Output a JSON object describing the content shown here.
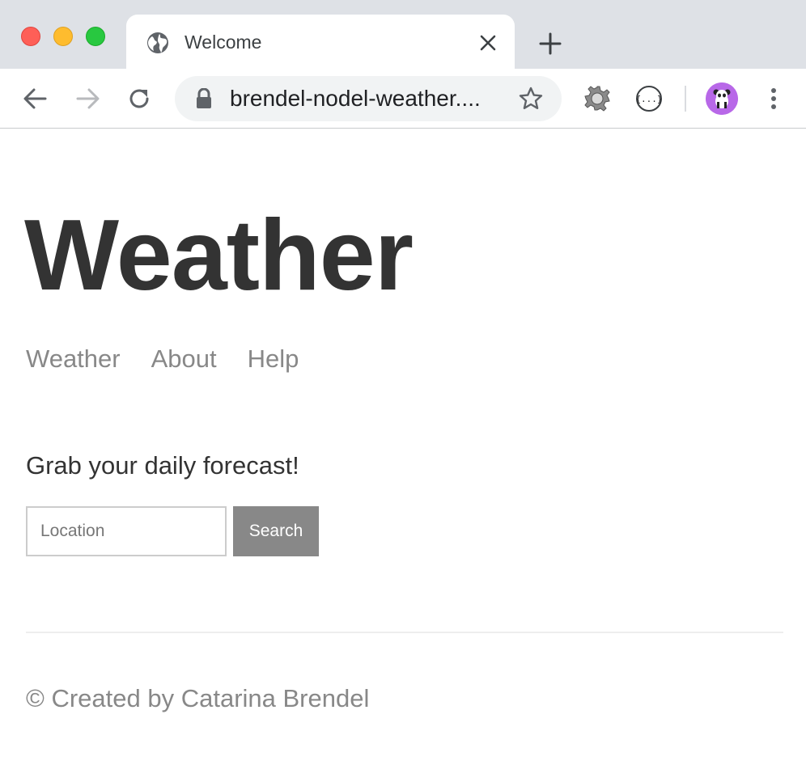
{
  "browser": {
    "tab": {
      "title": "Welcome"
    },
    "address_bar": {
      "url": "brendel-nodel-weather...."
    },
    "colors": {
      "close": "#fe5f57",
      "minimize": "#febc2e",
      "maximize": "#28c840",
      "avatar": "#b868e8"
    }
  },
  "page": {
    "site_title": "Weather",
    "nav": {
      "items": [
        "Weather",
        "About",
        "Help"
      ]
    },
    "tagline": "Grab your daily forecast!",
    "search": {
      "placeholder": "Location",
      "value": "",
      "button_label": "Search"
    },
    "footer": {
      "text": "© Created by Catarina Brendel"
    }
  }
}
